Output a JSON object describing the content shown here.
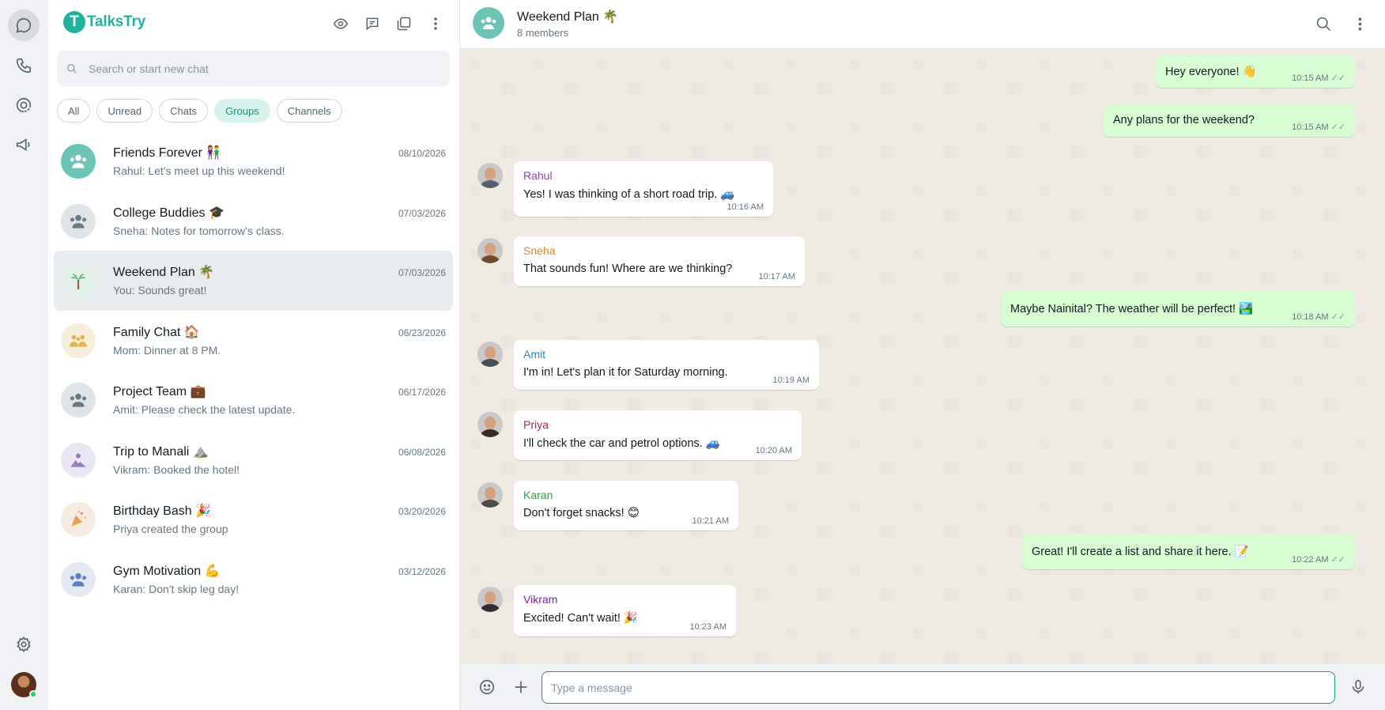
{
  "app": {
    "name": "TalksTry",
    "logo_letter": "T"
  },
  "search": {
    "placeholder": "Search or start new chat"
  },
  "filters": [
    {
      "label": "All",
      "active": false
    },
    {
      "label": "Unread",
      "active": false
    },
    {
      "label": "Chats",
      "active": false
    },
    {
      "label": "Groups",
      "active": true
    },
    {
      "label": "Channels",
      "active": false
    }
  ],
  "chats": [
    {
      "name": "Friends Forever 👫",
      "preview": "Rahul: Let's meet up this weekend!",
      "date": "08/10/2026",
      "avatar_color": "#6bc4b5",
      "avatar_icon": "group-icon"
    },
    {
      "name": "College Buddies 🎓",
      "preview": "Sneha: Notes for tomorrow's class.",
      "date": "07/03/2026",
      "avatar_color": "#dfe5e7",
      "avatar_icon": "group-icon"
    },
    {
      "name": "Weekend Plan 🌴",
      "preview": "You: Sounds great!",
      "date": "07/03/2026",
      "avatar_color": "#e3f1ea",
      "avatar_icon": "palm-tree-icon",
      "selected": true
    },
    {
      "name": "Family Chat 🏠",
      "preview": "Mom: Dinner at 8 PM.",
      "date": "06/23/2026",
      "avatar_color": "#f6efdc",
      "avatar_icon": "family-icon"
    },
    {
      "name": "Project Team 💼",
      "preview": "Amit: Please check the latest update.",
      "date": "06/17/2026",
      "avatar_color": "#dfe5e7",
      "avatar_icon": "group-icon"
    },
    {
      "name": "Trip to Manali ⛰️",
      "preview": "Vikram: Booked the hotel!",
      "date": "06/08/2026",
      "avatar_color": "#ebe6f3",
      "avatar_icon": "mountain-icon"
    },
    {
      "name": "Birthday Bash 🎉",
      "preview": "Priya created the group",
      "date": "03/20/2026",
      "avatar_color": "#f6ebe0",
      "avatar_icon": "party-icon"
    },
    {
      "name": "Gym Motivation 💪",
      "preview": "Karan: Don't skip leg day!",
      "date": "03/12/2026",
      "avatar_color": "#e3e8f1",
      "avatar_icon": "group-icon"
    }
  ],
  "conversation": {
    "title": "Weekend Plan 🌴",
    "subtitle": "8 members",
    "messages": [
      {
        "dir": "out",
        "text": "Hey everyone! 👋",
        "time": "10:15 AM"
      },
      {
        "dir": "out",
        "text": "Any plans for the weekend?",
        "time": "10:15 AM"
      },
      {
        "dir": "in",
        "sender": "Rahul",
        "sender_color": "#8e44ad",
        "avatar_body": "#56606a",
        "text": "Yes! I was thinking of a short road trip. 🚙",
        "time": "10:16 AM"
      },
      {
        "dir": "in",
        "sender": "Sneha",
        "sender_color": "#e67e22",
        "avatar_body": "#6d4c2c",
        "text": "That sounds fun! Where are we thinking?",
        "time": "10:17 AM"
      },
      {
        "dir": "out",
        "text": "Maybe Nainital? The weather will be perfect! 🏞️",
        "time": "10:18 AM"
      },
      {
        "dir": "in",
        "sender": "Amit",
        "sender_color": "#2e86c1",
        "avatar_body": "#4a4f55",
        "text": "I'm in! Let's plan it for Saturday morning.",
        "time": "10:19 AM"
      },
      {
        "dir": "in",
        "sender": "Priya",
        "sender_color": "#c2185b",
        "avatar_body": "#3b2a24",
        "text": "I'll check the car and petrol options. 🚙",
        "time": "10:20 AM"
      },
      {
        "dir": "in",
        "sender": "Karan",
        "sender_color": "#2e9e44",
        "avatar_body": "#4e4a46",
        "text": "Don't forget snacks! 😊",
        "time": "10:21 AM"
      },
      {
        "dir": "out",
        "text": "Great! I'll create a list and share it here. 📝",
        "time": "10:22 AM"
      },
      {
        "dir": "in",
        "sender": "Vikram",
        "sender_color": "#7b1fa2",
        "avatar_body": "#2d2d32",
        "text": "Excited! Can't wait! 🎉",
        "time": "10:23 AM"
      }
    ]
  },
  "composer": {
    "placeholder": "Type a message"
  },
  "ticks_glyph": "✓✓"
}
